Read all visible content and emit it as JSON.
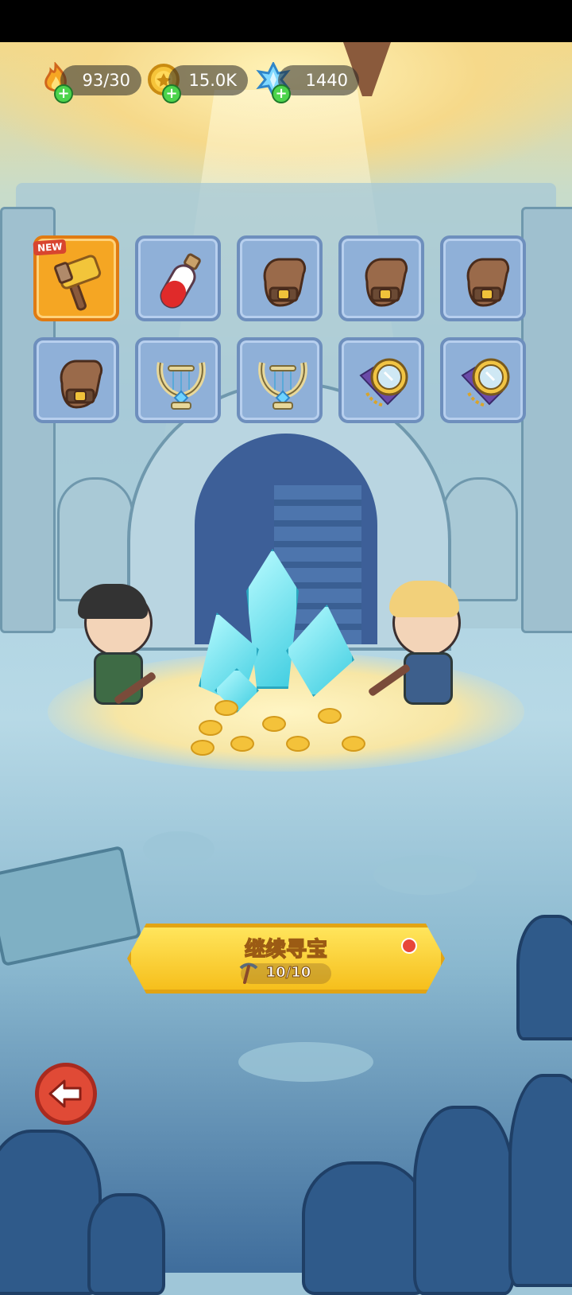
{
  "hud": {
    "energy": {
      "icon": "fire-icon",
      "value": "93/30"
    },
    "coins": {
      "icon": "coin-icon",
      "value": "15.0K"
    },
    "gems": {
      "icon": "crystal-icon",
      "value": "1440"
    }
  },
  "loot_grid": {
    "items": [
      {
        "icon": "hammer-icon",
        "badge": "NEW",
        "highlight": true
      },
      {
        "icon": "potion-icon"
      },
      {
        "icon": "glove-icon"
      },
      {
        "icon": "glove-icon"
      },
      {
        "icon": "glove-icon"
      },
      {
        "icon": "glove-icon"
      },
      {
        "icon": "lyre-icon"
      },
      {
        "icon": "lyre-icon"
      },
      {
        "icon": "mirror-icon"
      },
      {
        "icon": "mirror-icon"
      }
    ]
  },
  "continue_button": {
    "label": "继续寻宝",
    "count": "10/10",
    "icon": "pickaxe-icon"
  },
  "back_button": {
    "icon": "back-arrow-icon"
  },
  "colors": {
    "accent": "#f6bf1c",
    "slot": "#8fb0d8",
    "highlight": "#f5a623"
  }
}
